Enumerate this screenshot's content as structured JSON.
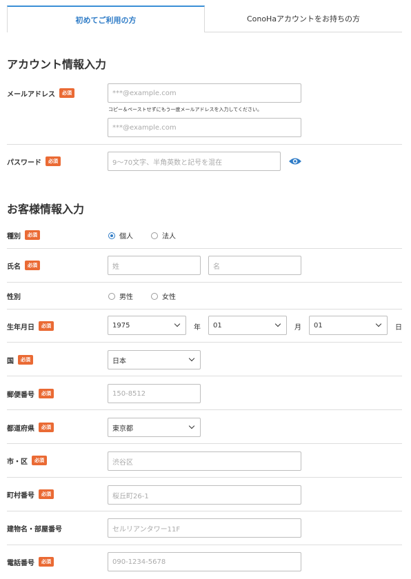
{
  "tabs": [
    {
      "label": "初めてご利用の方"
    },
    {
      "label": "ConoHaアカウントをお持ちの方"
    }
  ],
  "account_section": {
    "title": "アカウント情報入力",
    "email_label": "メールアドレス",
    "email_placeholder": "***@example.com",
    "email_hint": "コピー＆ペーストせずにもう一度メールアドレスを入力してください。",
    "email_confirm_placeholder": "***@example.com",
    "password_label": "パスワード",
    "password_placeholder": "9〜70文字、半角英数と記号を混在"
  },
  "required_badge": "必須",
  "customer_section": {
    "title": "お客様情報入力",
    "type_label": "種別",
    "type_options": [
      "個人",
      "法人"
    ],
    "type_selected": "個人",
    "name_label": "氏名",
    "last_name_placeholder": "姓",
    "first_name_placeholder": "名",
    "gender_label": "性別",
    "gender_options": [
      "男性",
      "女性"
    ],
    "birth_label": "生年月日",
    "birth_year": "1975",
    "birth_year_unit": "年",
    "birth_month": "01",
    "birth_month_unit": "月",
    "birth_day": "01",
    "birth_day_unit": "日",
    "country_label": "国",
    "country_value": "日本",
    "postal_label": "郵便番号",
    "postal_placeholder": "150-8512",
    "prefecture_label": "都道府県",
    "prefecture_value": "東京都",
    "city_label": "市・区",
    "city_placeholder": "渋谷区",
    "town_label": "町村番号",
    "town_placeholder": "桜丘町26-1",
    "building_label": "建物名・部屋番号",
    "building_placeholder": "セルリアンタワー11F",
    "phone_label": "電話番号",
    "phone_placeholder": "090-1234-5678"
  },
  "colors": {
    "accent": "#2f7cc7",
    "required": "#ea6a34",
    "border": "#bdbdbd"
  }
}
